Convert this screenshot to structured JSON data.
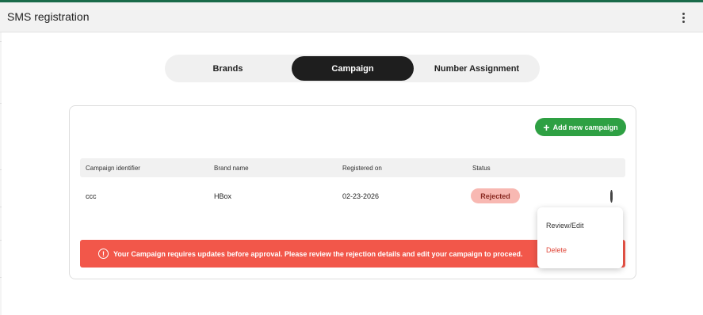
{
  "header": {
    "title": "SMS registration",
    "menu_icon": "more-vertical-icon"
  },
  "tabs": [
    {
      "label": "Brands",
      "active": false
    },
    {
      "label": "Campaign",
      "active": true
    },
    {
      "label": "Number Assignment",
      "active": false
    }
  ],
  "toolbar": {
    "add_label": "Add new campaign",
    "add_icon": "plus-icon",
    "accent": "#2ea043"
  },
  "table": {
    "columns": [
      "Campaign identifier",
      "Brand name",
      "Registered on",
      "Status"
    ],
    "rows": [
      {
        "identifier": "ccc",
        "brand": "HBox",
        "registered_on": "02-23-2026",
        "status": "Rejected"
      }
    ]
  },
  "alert": {
    "message": "Your Campaign requires updates before approval. Please review the rejection details and edit your campaign to proceed.",
    "icon": "info-icon",
    "color": "#f2574a"
  },
  "context_menu": {
    "items": [
      {
        "label": "Review/Edit"
      },
      {
        "label": "Delete"
      }
    ]
  },
  "colors": {
    "header_accent": "#1a6b4a",
    "delete": "#e0483b",
    "rejected_badge": "#f8b8b2"
  }
}
